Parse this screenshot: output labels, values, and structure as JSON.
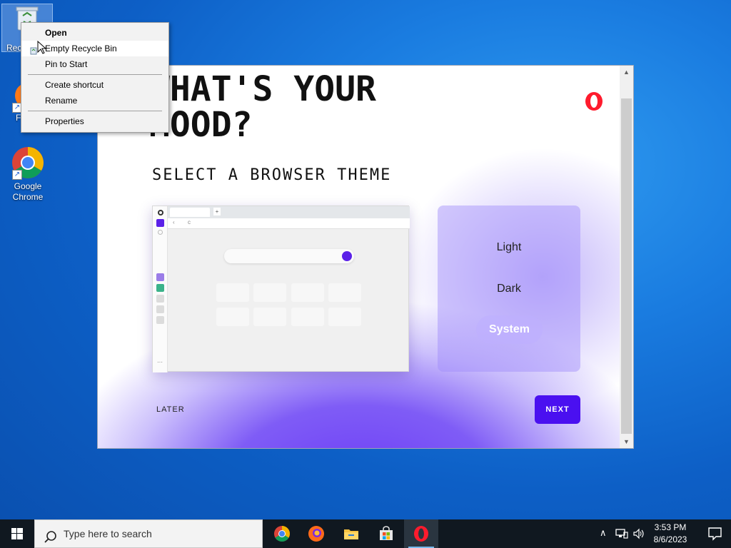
{
  "desktop": {
    "icons": [
      {
        "label": "Recycle Bin",
        "visible_label": "Rec"
      },
      {
        "label": "F"
      },
      {
        "label_line1": "Google",
        "label_line2": "Chrome"
      }
    ]
  },
  "context_menu": {
    "items": [
      {
        "label": "Open",
        "bold": true
      },
      {
        "label": "Empty Recycle Bin"
      },
      {
        "label": "Pin to Start"
      },
      {
        "label": "Create shortcut"
      },
      {
        "label": "Rename"
      },
      {
        "label": "Properties"
      }
    ]
  },
  "opera_window": {
    "title_line1": "WHAT'S YOUR",
    "title_line2": "MOOD?",
    "subtitle": "SELECT A BROWSER THEME",
    "theme_options": [
      {
        "label": "Light",
        "selected": false
      },
      {
        "label": "Dark",
        "selected": false
      },
      {
        "label": "System",
        "selected": true
      }
    ],
    "later_label": "LATER",
    "next_label": "NEXT",
    "accent_color": "#4a10f0",
    "logo": "opera-logo-icon"
  },
  "taskbar": {
    "search_placeholder": "Type here to search",
    "apps": [
      "chrome-icon",
      "firefox-icon",
      "file-explorer-icon",
      "microsoft-store-icon",
      "opera-icon"
    ],
    "clock_time": "3:53 PM",
    "clock_date": "8/6/2023"
  }
}
